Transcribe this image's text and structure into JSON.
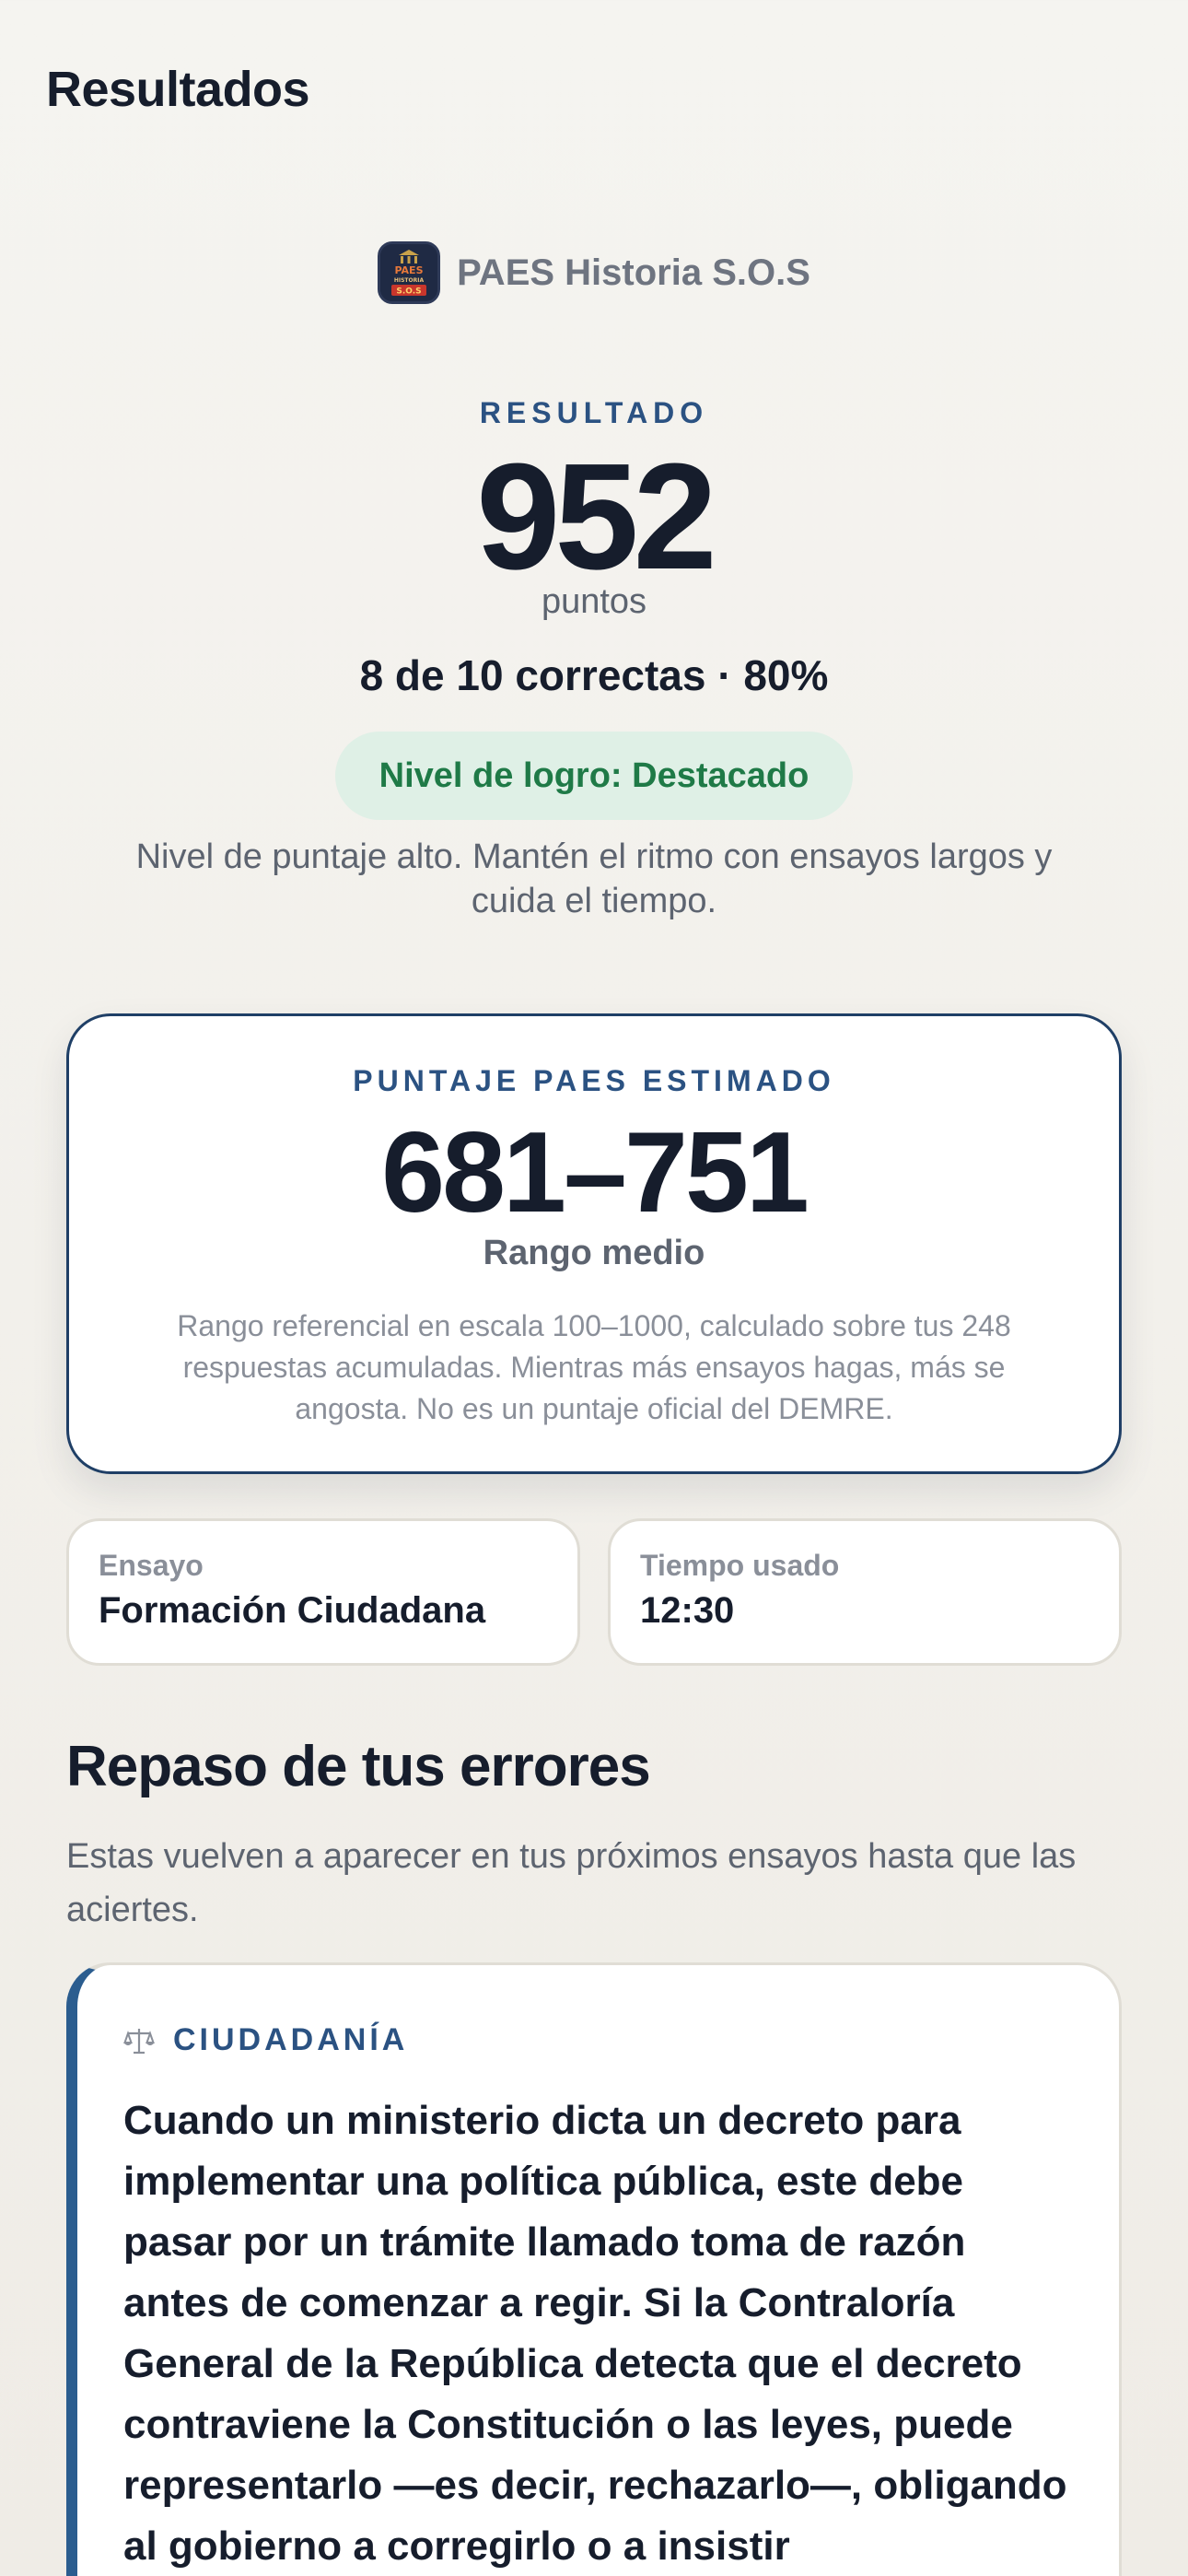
{
  "header": {
    "title": "Resultados"
  },
  "brand": {
    "name": "PAES Historia S.O.S",
    "logo_text_top": "PAES",
    "logo_text_mid": "HISTORIA",
    "logo_text_bottom": "S.O.S",
    "logo_icon": "landmark-icon"
  },
  "result": {
    "label": "RESULTADO",
    "score": "952",
    "unit": "puntos",
    "correct_summary": "8 de 10 correctas · 80%",
    "level_badge": "Nivel de logro: Destacado",
    "level_description": "Nivel de puntaje alto. Mantén el ritmo con ensayos largos y cuida el tiempo."
  },
  "estimate": {
    "label": "PUNTAJE PAES ESTIMADO",
    "range": "681–751",
    "range_label": "Rango medio",
    "note": "Rango referencial en escala 100–1000, calculado sobre tus 248 respuestas acumuladas. Mientras más ensayos hagas, más se angosta. No es un puntaje oficial del DEMRE."
  },
  "info": {
    "essay_label": "Ensayo",
    "essay_value": "Formación Ciudadana",
    "time_label": "Tiempo usado",
    "time_value": "12:30"
  },
  "errors": {
    "title": "Repaso de tus errores",
    "description": "Estas vuelven a aparecer en tus próximos ensayos hasta que las aciertes.",
    "items": [
      {
        "category_icon": "scales-icon",
        "category": "CIUDADANÍA",
        "question": "Cuando un ministerio dicta un decreto para implementar una política pública, este debe pasar por un trámite llamado toma de razón antes de comenzar a regir. Si la Contraloría General de la República detecta que el decreto contraviene la Constitución o las leyes, puede representarlo —es decir, rechazarlo—, obligando al gobierno a corregirlo o a insistir"
      }
    ]
  },
  "colors": {
    "accent_blue": "#2b5282",
    "badge_green_bg": "#dff0e6",
    "badge_green_text": "#1f7a47",
    "card_border": "#1f3f66",
    "question_accent": "#2b5d8f"
  }
}
